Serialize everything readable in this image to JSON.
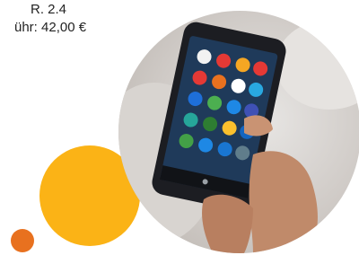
{
  "caption": {
    "line1": "R. 2.4",
    "line2": "ühr: 42,00 €"
  },
  "colors": {
    "orange_dot": "#e8711f",
    "yellow_circle": "#fbb316"
  },
  "image": {
    "subject": "hand holding smartphone showing app icons"
  }
}
